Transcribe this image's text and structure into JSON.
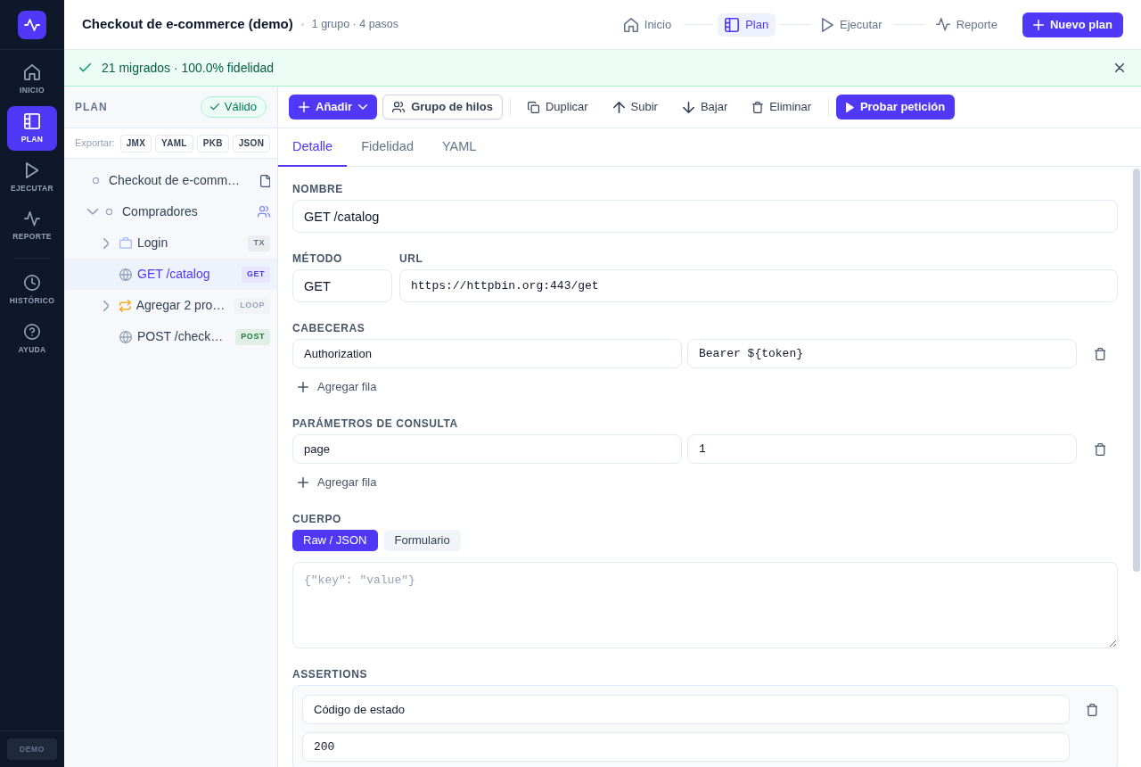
{
  "rail": {
    "items": [
      {
        "kind": "home",
        "label": "INICIO",
        "selected": false
      },
      {
        "kind": "plan",
        "label": "PLAN",
        "selected": true
      },
      {
        "kind": "run",
        "label": "EJECUTAR",
        "selected": false
      },
      {
        "kind": "report",
        "label": "REPORTE",
        "selected": false
      }
    ],
    "secondary_items": [
      {
        "kind": "history",
        "label": "HISTÓRICO",
        "selected": false
      },
      {
        "kind": "help",
        "label": "AYUDA",
        "selected": false
      }
    ],
    "footer_badge": "DEMO"
  },
  "header": {
    "title": "Checkout de e-commerce (demo)",
    "subtitle": "1 grupo · 4 pasos",
    "steps": [
      {
        "kind": "home",
        "label": "Inicio",
        "selected": false
      },
      {
        "kind": "plan",
        "label": "Plan",
        "selected": true
      },
      {
        "kind": "run",
        "label": "Ejecutar",
        "selected": false
      },
      {
        "kind": "report",
        "label": "Reporte",
        "selected": false
      }
    ],
    "new_plan_button": "Nuevo plan"
  },
  "banner": {
    "text": "21 migrados · 100.0% fidelidad"
  },
  "plan_panel": {
    "title": "PLAN",
    "status": {
      "text": "Válido",
      "valid": true
    },
    "export_label": "Exportar:",
    "export_formats": [
      "JMX",
      "YAML",
      "PKB",
      "JSON"
    ],
    "tree": [
      {
        "kind": "plan",
        "label": "Checkout de e-comm…",
        "selected": false,
        "children": [
          {
            "kind": "thread_group",
            "label": "Compradores",
            "expanded": true,
            "selected": false,
            "children": [
              {
                "kind": "transaction",
                "label": "Login",
                "expanded": false,
                "selected": false,
                "badge": {
                  "text": "TX",
                  "color": "#64748b"
                }
              },
              {
                "kind": "request",
                "label": "GET /catalog",
                "selected": true,
                "badge": {
                  "text": "GET",
                  "color": "#4f39f6"
                }
              },
              {
                "kind": "loop",
                "label": "Agregar 2 pro…",
                "expanded": false,
                "selected": false,
                "badge": {
                  "text": "LOOP",
                  "color": "#94a3b8"
                }
              },
              {
                "kind": "request",
                "label": "POST /check…",
                "selected": false,
                "badge": {
                  "text": "POST",
                  "color": "#15803d"
                }
              }
            ]
          }
        ]
      }
    ]
  },
  "toolbar_groups": [
    [
      {
        "kind": "add",
        "label": "Añadir"
      },
      {
        "kind": "thread_group",
        "label": "Grupo de hilos"
      }
    ],
    [
      {
        "kind": "duplicate",
        "label": "Duplicar"
      },
      {
        "kind": "move_up",
        "label": "Subir"
      },
      {
        "kind": "move_down",
        "label": "Bajar"
      },
      {
        "kind": "delete",
        "label": "Eliminar"
      }
    ],
    [
      {
        "kind": "run",
        "label": "Probar petición"
      }
    ]
  ],
  "tabs": [
    {
      "label": "Detalle",
      "selected": true
    },
    {
      "label": "Fidelidad",
      "selected": false
    },
    {
      "label": "YAML",
      "selected": false
    }
  ],
  "detail": {
    "name": {
      "label": "NOMBRE",
      "value": "GET /catalog"
    },
    "method": {
      "label": "MÉTODO",
      "value": "GET"
    },
    "url": {
      "label": "URL",
      "value": "https://httpbin.org:443/get"
    },
    "headers": {
      "label": "CABECERAS",
      "rows": [
        {
          "key": "Authorization",
          "value": "Bearer ${token}"
        }
      ],
      "add_label": "Agregar fila"
    },
    "query_params": {
      "label": "PARÁMETROS DE CONSULTA",
      "rows": [
        {
          "key": "page",
          "value": "1"
        }
      ],
      "add_label": "Agregar fila"
    },
    "body": {
      "label": "CUERPO",
      "modes": [
        {
          "label": "Raw / JSON",
          "selected": true
        },
        {
          "label": "Formulario",
          "selected": false
        }
      ],
      "placeholder": "{\"key\": \"value\"}"
    },
    "assertions": {
      "label": "ASSERTIONS",
      "items": [
        {
          "type": "Código de estado",
          "value": "200"
        }
      ]
    }
  }
}
